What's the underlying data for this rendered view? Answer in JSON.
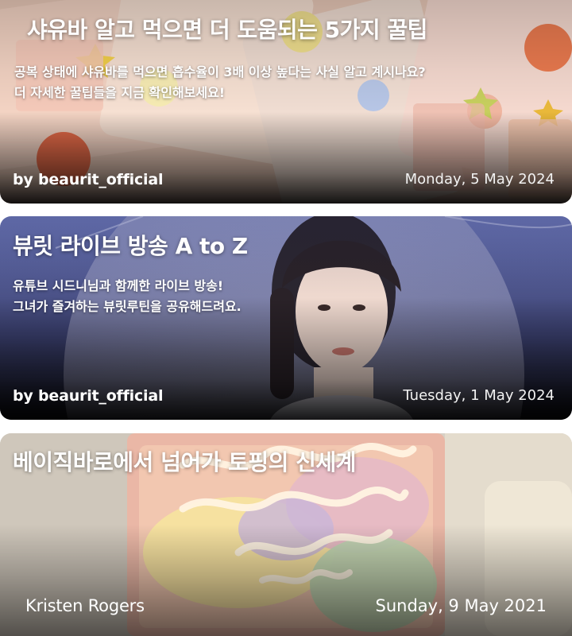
{
  "posts": [
    {
      "title": "샤유바 알고 먹으면 더 도움되는 5가지 꿀팁",
      "description_lines": [
        "공복 상태에 샤유바를 먹으면 흡수율이 3배 이상 높다는 사실 알고 계시나요?",
        "더 자세한 꿀팁들을 지금 확인해보세요!"
      ],
      "author": "by beaurit_official",
      "date": "Monday, 5 May 2024"
    },
    {
      "title": "뷰릿 라이브 방송 A to Z",
      "description_lines": [
        "유튜브 시드니님과 함께한 라이브 방송!",
        "그녀가 즐겨하는 뷰릿루틴을 공유해드려요."
      ],
      "author": "by beaurit_official",
      "date": "Tuesday, 1 May 2024"
    },
    {
      "title": "베이직바로에서 넘어가 토핑의 신세계",
      "author": "Kristen Rogers",
      "date": "Sunday, 9 May 2021"
    }
  ]
}
